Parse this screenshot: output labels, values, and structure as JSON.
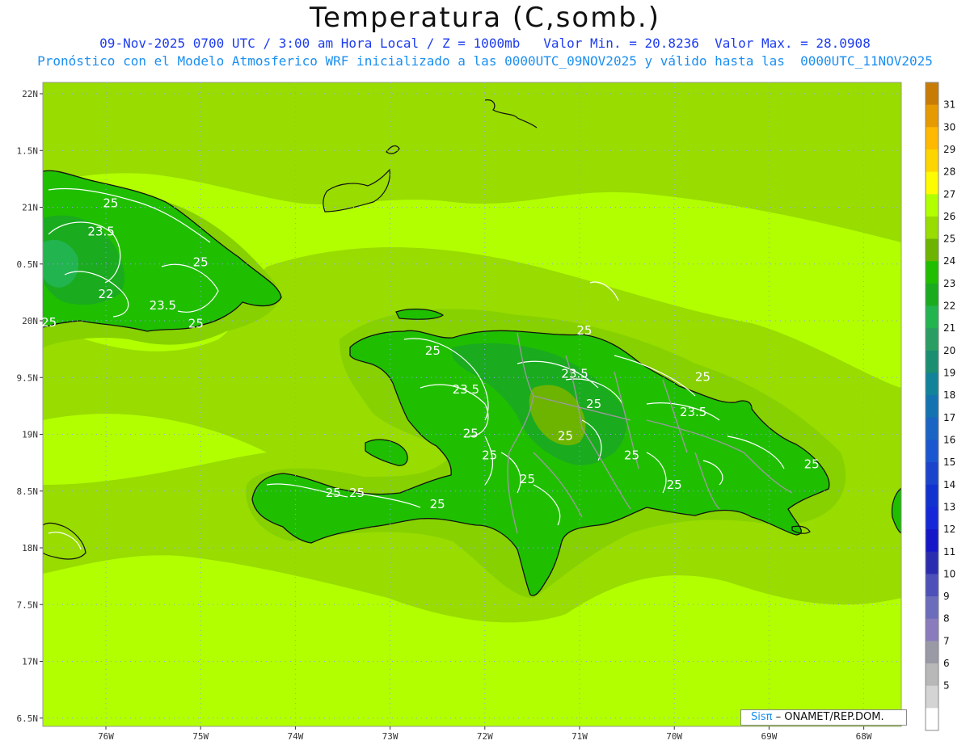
{
  "title": "Temperatura (C,somb.)",
  "subtitle_line1": "09-Nov-2025 0700 UTC / 3:00 am Hora Local / Z = 1000mb   Valor Min. = 20.8236  Valor Max. = 28.0908",
  "subtitle_line2": "Pronóstico con el Modelo Atmosferico WRF inicializado a las 0000UTC_09NOV2025 y válido hasta las  0000UTC_11NOV2025",
  "lat_labels": [
    "22N",
    "1.5N",
    "21N",
    "0.5N",
    "20N",
    "9.5N",
    "19N",
    "8.5N",
    "18N",
    "7.5N",
    "17N",
    "6.5N"
  ],
  "lon_labels": [
    "76W",
    "75W",
    "74W",
    "73W",
    "72W",
    "71W",
    "70W",
    "69W",
    "68W"
  ],
  "contour_labels": [
    {
      "text": "25",
      "lon": -75.95,
      "lat": 21.0
    },
    {
      "text": "23.5",
      "lon": -76.05,
      "lat": 20.75
    },
    {
      "text": "25",
      "lon": -75.0,
      "lat": 20.48
    },
    {
      "text": "22",
      "lon": -76.0,
      "lat": 20.2
    },
    {
      "text": "23.5",
      "lon": -75.4,
      "lat": 20.1
    },
    {
      "text": "25",
      "lon": -76.6,
      "lat": 19.95
    },
    {
      "text": "25",
      "lon": -75.05,
      "lat": 19.94
    },
    {
      "text": "25",
      "lon": -70.95,
      "lat": 19.88
    },
    {
      "text": "25",
      "lon": -72.55,
      "lat": 19.7
    },
    {
      "text": "23.5",
      "lon": -71.05,
      "lat": 19.5
    },
    {
      "text": "25",
      "lon": -69.7,
      "lat": 19.47
    },
    {
      "text": "23.5",
      "lon": -72.2,
      "lat": 19.36
    },
    {
      "text": "25",
      "lon": -70.85,
      "lat": 19.23
    },
    {
      "text": "23.5",
      "lon": -69.8,
      "lat": 19.16
    },
    {
      "text": "25",
      "lon": -72.15,
      "lat": 18.97
    },
    {
      "text": "25",
      "lon": -71.15,
      "lat": 18.95
    },
    {
      "text": "25",
      "lon": -71.95,
      "lat": 18.78
    },
    {
      "text": "25",
      "lon": -70.45,
      "lat": 18.78
    },
    {
      "text": "25",
      "lon": -68.55,
      "lat": 18.7
    },
    {
      "text": "25",
      "lon": -71.55,
      "lat": 18.57
    },
    {
      "text": "25",
      "lon": -70.0,
      "lat": 18.52
    },
    {
      "text": "25",
      "lon": -73.6,
      "lat": 18.45
    },
    {
      "text": "25",
      "lon": -73.35,
      "lat": 18.45
    },
    {
      "text": "25",
      "lon": -72.5,
      "lat": 18.35
    }
  ],
  "legend": {
    "values": [
      "31",
      "30",
      "29",
      "28",
      "27",
      "26",
      "25",
      "24",
      "23",
      "22",
      "21",
      "20",
      "19",
      "18",
      "17",
      "16",
      "15",
      "14",
      "13",
      "12",
      "11",
      "10",
      "9",
      "8",
      "7",
      "6",
      "5"
    ],
    "colors": [
      "#c87c06",
      "#e59a00",
      "#ffb900",
      "#ffd500",
      "#fffb00",
      "#b2ff00",
      "#98dc00",
      "#6cb400",
      "#1fbf00",
      "#1aab1f",
      "#22b44f",
      "#2a9e62",
      "#1a8e70",
      "#10829a",
      "#1372b0",
      "#1a64c4",
      "#1a56d0",
      "#1a44cc",
      "#1232d0",
      "#1428d8",
      "#1416c8",
      "#2a2cb0",
      "#4c50b8",
      "#6c6cbc",
      "#8a7cbc",
      "#9a9aa6",
      "#b8b8b8",
      "#d4d4d4",
      "#ffffff"
    ]
  },
  "credit": {
    "brand": "Sisπ",
    "org": "– ONAMET/REP.DOM."
  },
  "colors": {
    "sea": "#b2ff00",
    "shelf": "#98dc00",
    "coast_band": "#87d100",
    "land_warm": "#6cb400",
    "land": "#1fbf00",
    "land_cool": "#1aab1f"
  }
}
